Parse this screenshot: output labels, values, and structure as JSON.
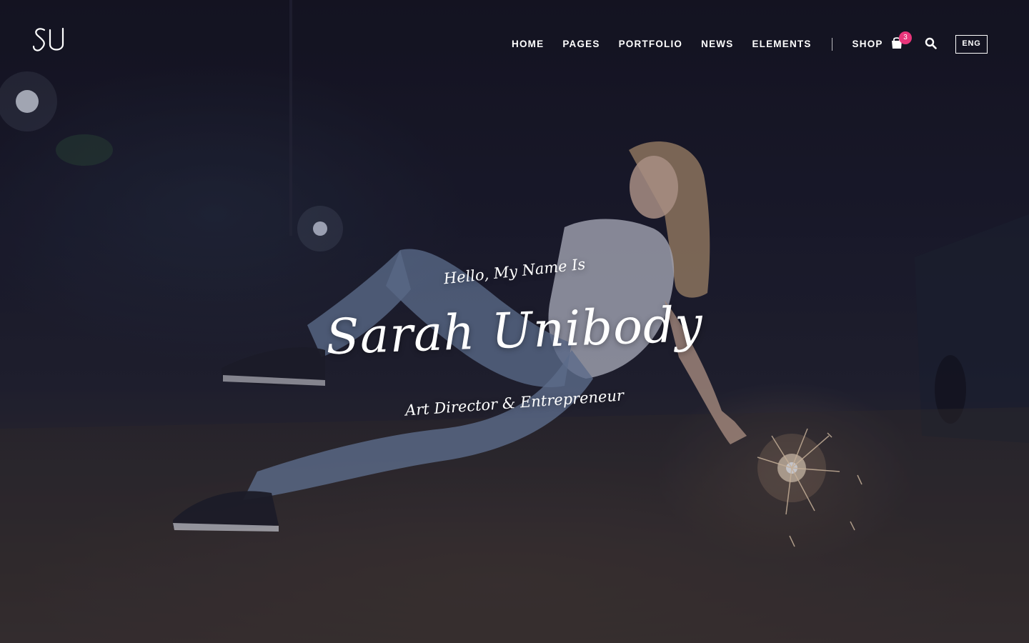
{
  "header": {
    "logo_text": "SU",
    "nav": [
      {
        "label": "HOME"
      },
      {
        "label": "PAGES"
      },
      {
        "label": "PORTFOLIO"
      },
      {
        "label": "NEWS"
      },
      {
        "label": "ELEMENTS"
      }
    ],
    "shop_label": "SHOP",
    "cart_count": "3",
    "language": "ENG",
    "icons": {
      "cart": "shopping-bag-icon",
      "search": "search-icon"
    }
  },
  "hero": {
    "greeting": "Hello, My Name Is",
    "name": "Sarah Unibody",
    "role": "Art Director & Entrepreneur"
  },
  "colors": {
    "accent": "#e8357a",
    "text": "#ffffff",
    "background": "#14131f"
  }
}
